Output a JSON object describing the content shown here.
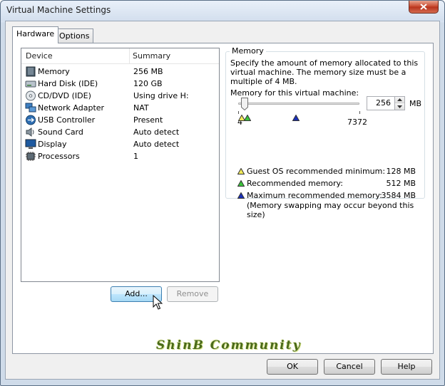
{
  "window": {
    "title": "Virtual Machine Settings"
  },
  "tabs": [
    {
      "label": "Hardware",
      "active": true
    },
    {
      "label": "Options",
      "active": false
    }
  ],
  "device_list": {
    "columns": [
      "Device",
      "Summary"
    ],
    "rows": [
      {
        "device": "Memory",
        "summary": "256 MB",
        "icon": "memory-icon"
      },
      {
        "device": "Hard Disk (IDE)",
        "summary": "120 GB",
        "icon": "hard-disk-icon"
      },
      {
        "device": "CD/DVD (IDE)",
        "summary": "Using drive H:",
        "icon": "cd-dvd-icon"
      },
      {
        "device": "Network Adapter",
        "summary": "NAT",
        "icon": "network-adapter-icon"
      },
      {
        "device": "USB Controller",
        "summary": "Present",
        "icon": "usb-icon"
      },
      {
        "device": "Sound Card",
        "summary": "Auto detect",
        "icon": "sound-card-icon"
      },
      {
        "device": "Display",
        "summary": "Auto detect",
        "icon": "display-icon"
      },
      {
        "device": "Processors",
        "summary": "1",
        "icon": "processor-icon"
      }
    ]
  },
  "list_buttons": {
    "add": "Add...",
    "remove": "Remove"
  },
  "memory": {
    "group_title": "Memory",
    "description": "Specify the amount of memory allocated to this virtual machine. The memory size must be a multiple of 4 MB.",
    "field_label": "Memory for this virtual machine:",
    "value": "256",
    "unit": "MB",
    "slider_min_label": "4",
    "slider_max_label": "7372",
    "legend": [
      {
        "label": "Guest OS recommended minimum:",
        "amount": "128 MB",
        "color": "#f2ea5a"
      },
      {
        "label": "Recommended memory:",
        "amount": "512 MB",
        "color": "#3cc43c"
      },
      {
        "label": "Maximum recommended memory:",
        "amount": "3584 MB",
        "color": "#1a2fb8"
      }
    ],
    "note": "(Memory swapping may occur beyond this size)"
  },
  "footer": {
    "watermark": "ShinB Community",
    "ok": "OK",
    "cancel": "Cancel",
    "help": "Help"
  }
}
